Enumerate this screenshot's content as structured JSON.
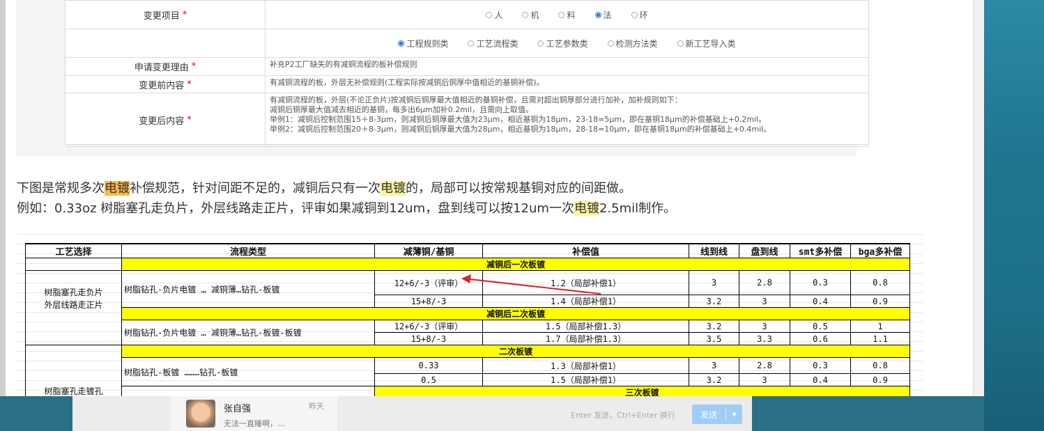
{
  "form": {
    "rows": [
      {
        "label": "变更项目",
        "required": "*",
        "kind": "radios",
        "options": [
          {
            "text": "人",
            "checked": false
          },
          {
            "text": "机",
            "checked": false
          },
          {
            "text": "料",
            "checked": false
          },
          {
            "text": "法",
            "checked": true
          },
          {
            "text": "环",
            "checked": false
          }
        ]
      },
      {
        "label": "",
        "required": "",
        "kind": "radios",
        "options": [
          {
            "text": "工程规则类",
            "checked": true
          },
          {
            "text": "工艺流程类",
            "checked": false
          },
          {
            "text": "工艺参数类",
            "checked": false
          },
          {
            "text": "检测方法类",
            "checked": false
          },
          {
            "text": "新工艺导入类",
            "checked": false
          }
        ]
      },
      {
        "label": "申请变更理由",
        "required": "*",
        "kind": "text",
        "lines": [
          "补充P2工厂缺失的有减铜流程的板补偿规则"
        ]
      },
      {
        "label": "变更前内容",
        "required": "*",
        "kind": "text",
        "lines": [
          "有减铜流程的板，外层无补偿规则(工程实际按减铜后铜厚中值相近的基铜补偿)。"
        ]
      },
      {
        "label": "变更后内容",
        "required": "*",
        "kind": "text",
        "lines": [
          "有减铜流程的板，外层(不论正负片)按减铜后铜厚最大值相近的基铜补偿，且需对超出铜厚部分进行加补，加补规则如下：",
          "减铜后铜厚最大值减去相近的基铜，每多出6μm加补0.2mil，且需向上取值。",
          "举例1：减铜后控制范围15＋8-3μm，则减铜后铜厚最大值为23μm，相近基铜为18μm，23-18=5μm，即在基铜18μm的补偿基础上+0.2mil。",
          "举例2：减铜后控制范围20＋8-3μm，则减铜后铜厚最大值为28μm，相近基铜为18μm，28-18=10μm，即在基铜18μm的补偿基础上+0.4mil。"
        ]
      }
    ]
  },
  "paragraph": {
    "line1": [
      {
        "t": "下图是常规多次",
        "hl": ""
      },
      {
        "t": "电镀",
        "hl": "orange"
      },
      {
        "t": "补偿规范，针对间距不足的，减铜后只有一次",
        "hl": ""
      },
      {
        "t": "电镀",
        "hl": "yellow"
      },
      {
        "t": "的，局部可以按常规基铜对应的间距做。",
        "hl": ""
      }
    ],
    "line2": [
      {
        "t": "例如：0.33oz 树脂塞孔走负片，外层线路走正片，评审如果减铜到12um，盘到线可以按12um一次",
        "hl": ""
      },
      {
        "t": "电镀",
        "hl": "yellow"
      },
      {
        "t": "2.5mil制作。",
        "hl": ""
      }
    ]
  },
  "table": {
    "headers": [
      "工艺选择",
      "流程类型",
      "减薄铜/基铜",
      "补偿值",
      "线到线",
      "盘到线",
      "smt多补偿",
      "bga多补偿"
    ],
    "section1": "减铜后一次板镀",
    "group1_label": "树脂塞孔走负片\n外层线路走正片",
    "flow1": "树脂钻孔-负片电镀 … 减铜薄…钻孔-板镀",
    "rows1": [
      [
        "12+6/-3（评审）",
        "1.2（局部补偿1）",
        "3",
        "2.8",
        "0.3",
        "0.8"
      ],
      [
        "15+8/-3",
        "1.4（局部补偿1）",
        "3.2",
        "3",
        "0.4",
        "0.9"
      ]
    ],
    "section2": "减铜后二次板镀",
    "flow2": "树脂钻孔-负片电镀 … 减铜薄…钻孔-板镀-板镀",
    "rows2": [
      [
        "12+6/-3（评审）",
        "1.5（局部补偿1.3）",
        "3.2",
        "3",
        "0.5",
        "1"
      ],
      [
        "15+8/-3",
        "1.7（局部补偿1.3）",
        "3.5",
        "3.3",
        "0.6",
        "1.1"
      ]
    ],
    "section3": "二次板镀",
    "flow3": "树脂钻孔-板镀 ………钻孔-板镀",
    "rows3": [
      [
        "0.33",
        "1.3（局部补偿1）",
        "3",
        "2.8",
        "0.3",
        "0.8"
      ],
      [
        "0.5",
        "1.5（局部补偿1）",
        "3.2",
        "3",
        "0.4",
        "0.9"
      ]
    ],
    "section4": "三次板镀",
    "group2_label": "树脂塞孔走镀孔"
  },
  "chat": {
    "contact_name": "张自强",
    "time": "昨天",
    "preview": "无法一直睡啊，…",
    "hint": "Enter 发送，Ctrl+Enter 换行",
    "send_label": "发送"
  },
  "colors": {
    "highlight_orange": "#f9b94c",
    "highlight_yellow": "#fdf3a0",
    "table_section": "#ffff00",
    "arrow": "#e02020",
    "send_button": "#9fcdf6"
  }
}
